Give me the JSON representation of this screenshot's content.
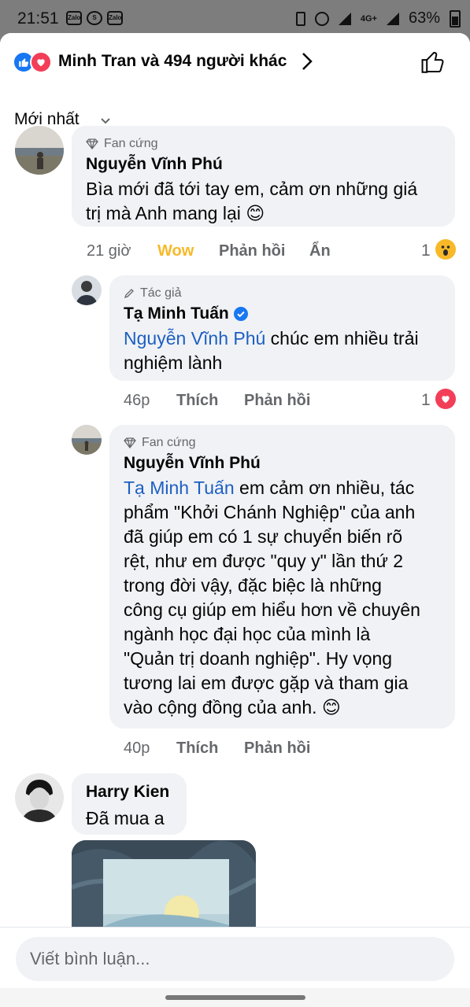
{
  "status_bar": {
    "time": "21:51",
    "app_icons": [
      "Zalo",
      "S",
      "Zalo"
    ],
    "network": "4G+",
    "battery": "63%"
  },
  "header": {
    "reactions_text": "Minh Tran và 494 người khác",
    "sort_label": "Mới nhất"
  },
  "comments": [
    {
      "badge": "Fan cứng",
      "author": "Nguyễn Vĩnh Phú",
      "line1": "Bìa mới đã tới tay em, cảm ơn những giá",
      "line2": "trị mà Anh mang lại 😊",
      "time": "21 giờ",
      "reaction_label": "Wow",
      "reply_label": "Phản hồi",
      "hide_label": "Ẩn",
      "reaction_count": "1",
      "reaction_icon": "wow-icon"
    },
    {
      "badge": "Tác giả",
      "author": "Tạ Minh Tuấn",
      "mention": "Nguyễn Vĩnh Phú",
      "line1_rest": " chúc em nhiều trải",
      "line2": "nghiệm lành",
      "time": "46p",
      "like_label": "Thích",
      "reply_label": "Phản hồi",
      "reaction_count": "1",
      "reaction_icon": "love-icon"
    },
    {
      "badge": "Fan cứng",
      "author": "Nguyễn Vĩnh Phú",
      "mention": "Tạ Minh Tuấn",
      "line1_rest": " em cảm ơn nhiều, tác",
      "lines": [
        "phẩm \"Khởi Chánh Nghiệp\" của anh",
        "đã giúp em có 1 sự chuyển biến rõ",
        "rệt, như em được \"quy y\" lần thứ 2",
        "trong đời vậy, đặc biệc là những",
        "công cụ giúp em hiểu hơn về chuyên",
        "ngành học đại học của mình là",
        "\"Quản trị doanh nghiệp\". Hy vọng",
        "tương lai em được gặp và tham gia",
        "vào cộng đồng của anh. 😊"
      ],
      "time": "40p",
      "like_label": "Thích",
      "reply_label": "Phản hồi"
    },
    {
      "author": "Harry Kien",
      "text": "Đã mua a"
    }
  ],
  "composer": {
    "placeholder": "Viết bình luận..."
  },
  "colors": {
    "mention": "#1d5fc2",
    "wow": "#f7b928",
    "bubble": "#f0f2f5",
    "like_blue": "#1877f2",
    "love_red": "#f33e58"
  }
}
